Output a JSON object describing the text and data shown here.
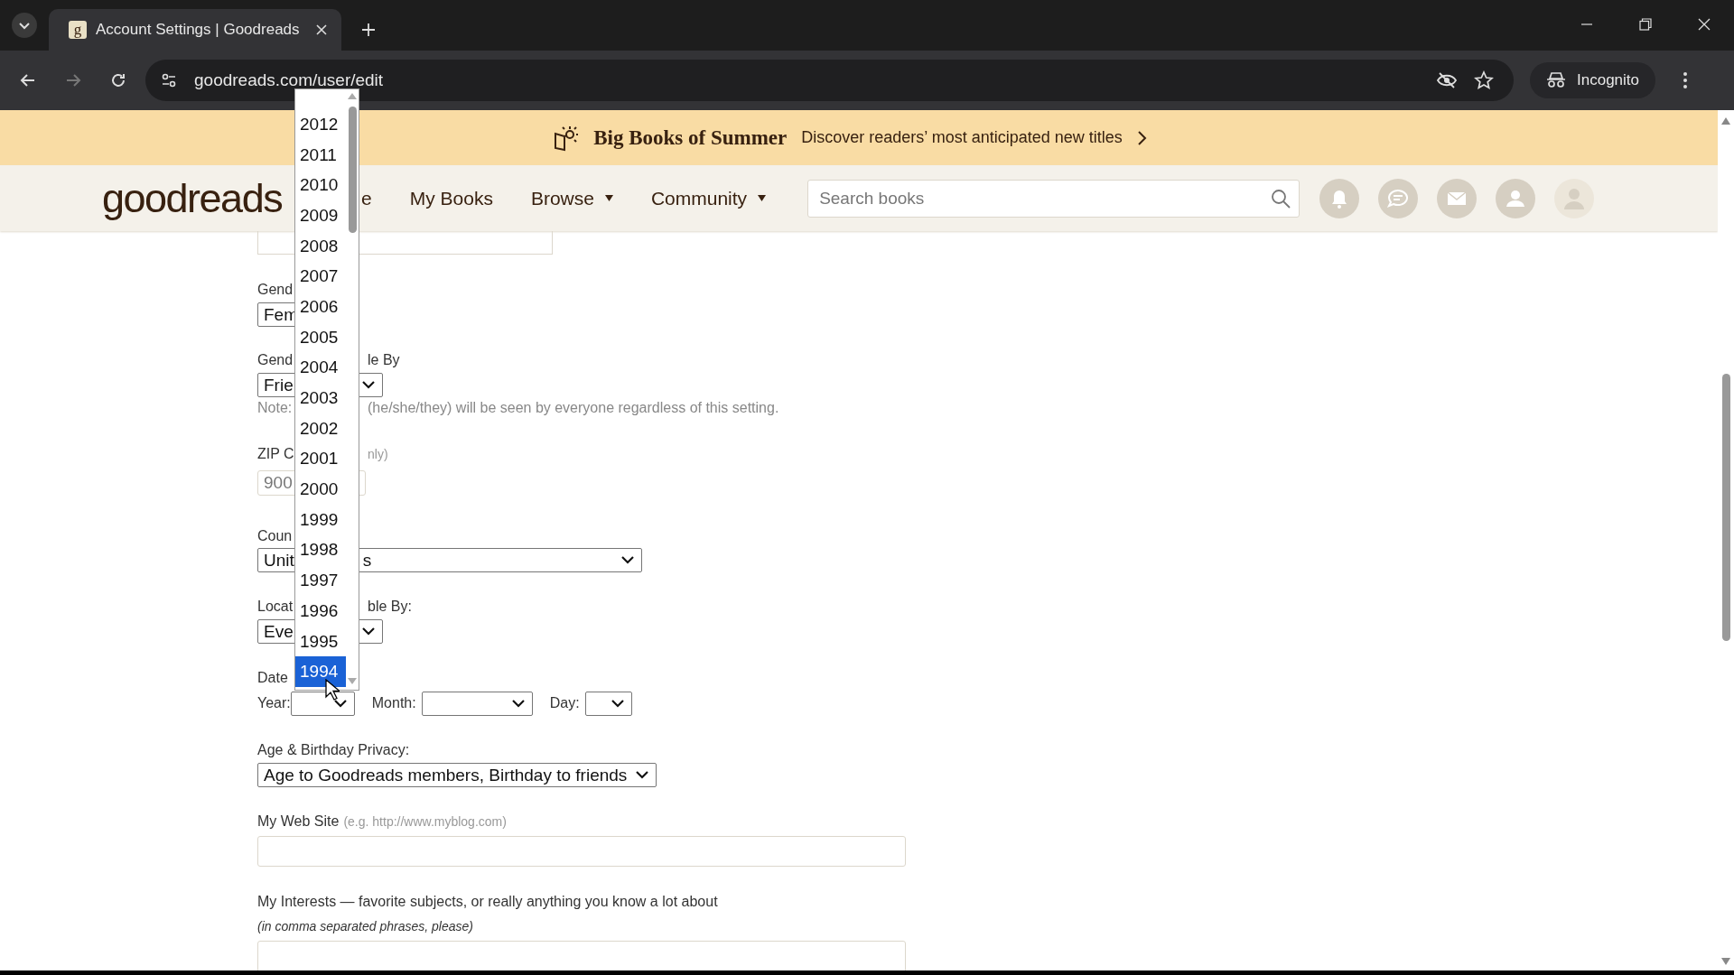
{
  "browser": {
    "tab_title": "Account Settings | Goodreads",
    "favicon": "g",
    "url": "goodreads.com/user/edit",
    "incognito_label": "Incognito"
  },
  "banner": {
    "title": "Big Books of Summer",
    "text": "Discover readers’ most anticipated new titles"
  },
  "nav": {
    "logo": "goodreads",
    "items": [
      {
        "label": "e",
        "dropdown": false
      },
      {
        "label": "My Books",
        "dropdown": false
      },
      {
        "label": "Browse",
        "dropdown": true
      },
      {
        "label": "Community",
        "dropdown": true
      }
    ],
    "search": {
      "placeholder": "Search books"
    }
  },
  "form": {
    "gender": {
      "label_left": "Gend",
      "value_left": "Fem"
    },
    "gender_viewable": {
      "label_left": "Gend",
      "label_right": "le By",
      "value_left": "Frie"
    },
    "note": {
      "left": "Note:",
      "right": "(he/she/they) will be seen by everyone regardless of this setting."
    },
    "zip": {
      "label_left": "ZIP C",
      "label_right": "nly)",
      "value": "900"
    },
    "country": {
      "label_left": "Coun",
      "value_left": "Unit",
      "value_right": "s"
    },
    "location_viewable": {
      "label_left": "Locat",
      "label_right": "ble By:",
      "value_left": "Eve"
    },
    "birth_date": {
      "label": "Date",
      "year_label": "Year:",
      "month_label": "Month:",
      "day_label": "Day:"
    },
    "privacy": {
      "label": "Age & Birthday Privacy:",
      "value": "Age to Goodreads members, Birthday to friends"
    },
    "website": {
      "label": "My Web Site",
      "hint": "(e.g. http://www.myblog.com)"
    },
    "interests": {
      "label": "My Interests — favorite subjects, or really anything you know a lot about",
      "hint": "(in comma separated phrases, please)"
    }
  },
  "year_dropdown": {
    "options": [
      {
        "label": "2012",
        "selected": false
      },
      {
        "label": "2011",
        "selected": false
      },
      {
        "label": "2010",
        "selected": false
      },
      {
        "label": "2009",
        "selected": false
      },
      {
        "label": "2008",
        "selected": false
      },
      {
        "label": "2007",
        "selected": false
      },
      {
        "label": "2006",
        "selected": false
      },
      {
        "label": "2005",
        "selected": false
      },
      {
        "label": "2004",
        "selected": false
      },
      {
        "label": "2003",
        "selected": false
      },
      {
        "label": "2002",
        "selected": false
      },
      {
        "label": "2001",
        "selected": false
      },
      {
        "label": "2000",
        "selected": false
      },
      {
        "label": "1999",
        "selected": false
      },
      {
        "label": "1998",
        "selected": false
      },
      {
        "label": "1997",
        "selected": false
      },
      {
        "label": "1996",
        "selected": false
      },
      {
        "label": "1995",
        "selected": false
      },
      {
        "label": "1994",
        "selected": true
      }
    ]
  }
}
